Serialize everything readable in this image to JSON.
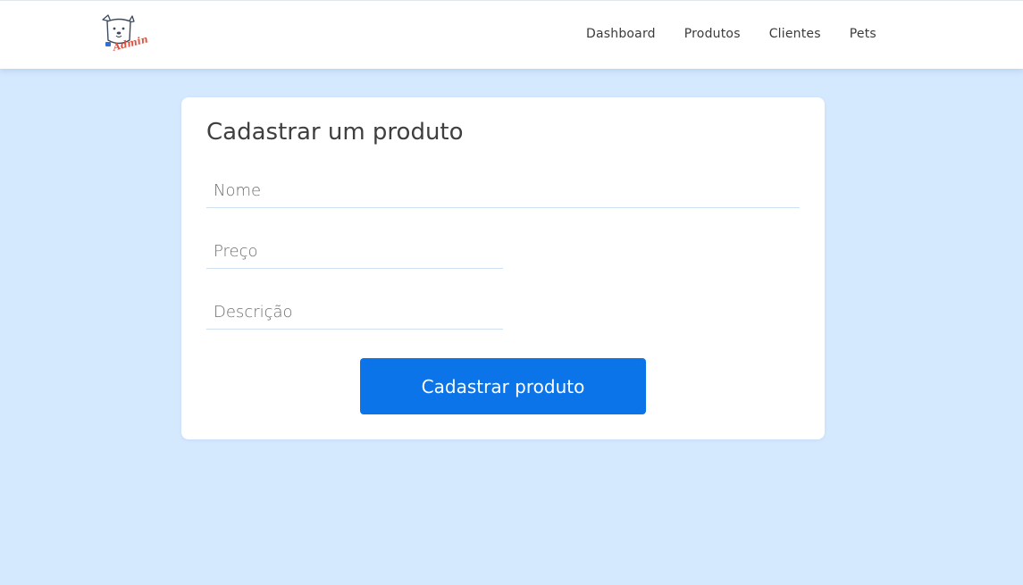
{
  "header": {
    "logo": {
      "icon": "dog-mascot-icon",
      "word": "Admin"
    },
    "nav": [
      {
        "label": "Dashboard"
      },
      {
        "label": "Produtos"
      },
      {
        "label": "Clientes"
      },
      {
        "label": "Pets"
      }
    ]
  },
  "form": {
    "title": "Cadastrar um produto",
    "fields": {
      "nome": {
        "placeholder": "Nome",
        "value": ""
      },
      "preco": {
        "placeholder": "Preço",
        "value": ""
      },
      "descricao": {
        "placeholder": "Descrição",
        "value": ""
      }
    },
    "submit_label": "Cadastrar produto"
  },
  "colors": {
    "background": "#d4e8fe",
    "accent": "#0b74e8",
    "logo_text": "#e0523f"
  }
}
